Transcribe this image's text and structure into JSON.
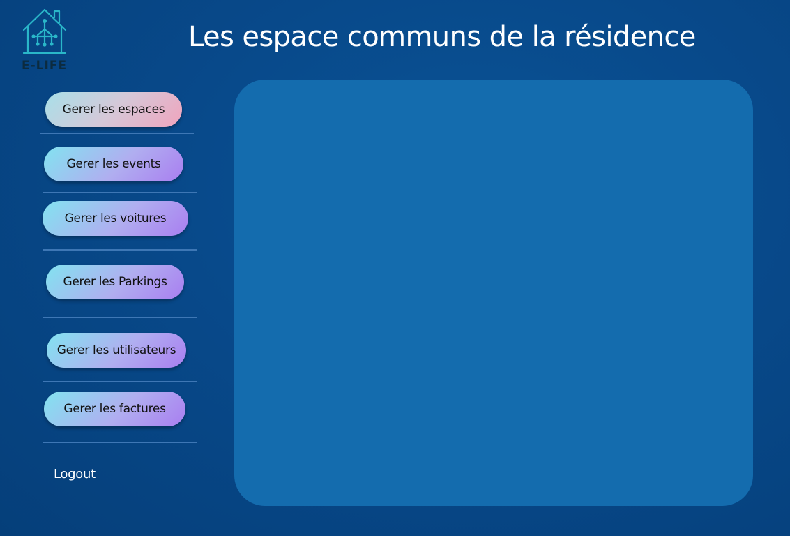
{
  "app": {
    "logo_text": "E-LIFE"
  },
  "header": {
    "title": "Les espace communs de la résidence"
  },
  "sidebar": {
    "items": [
      {
        "label": "Gerer les espaces",
        "active": true
      },
      {
        "label": "Gerer les events",
        "active": false
      },
      {
        "label": "Gerer les voitures",
        "active": false
      },
      {
        "label": "Gerer les Parkings",
        "active": false
      },
      {
        "label": "Gerer les utilisateurs",
        "active": false
      },
      {
        "label": "Gerer les factures",
        "active": false
      }
    ],
    "logout_label": "Logout"
  },
  "icons": {
    "logo": "smart-house-icon"
  },
  "colors": {
    "background": "#08498a",
    "content_panel": "#146cae",
    "logo_stroke": "#2ab7c9",
    "divider": "#3e77b5",
    "active_button_gradient": [
      "#a8e0e9",
      "#f0a4bd"
    ],
    "button_gradient": [
      "#82e3f0",
      "#a97ef0"
    ]
  }
}
